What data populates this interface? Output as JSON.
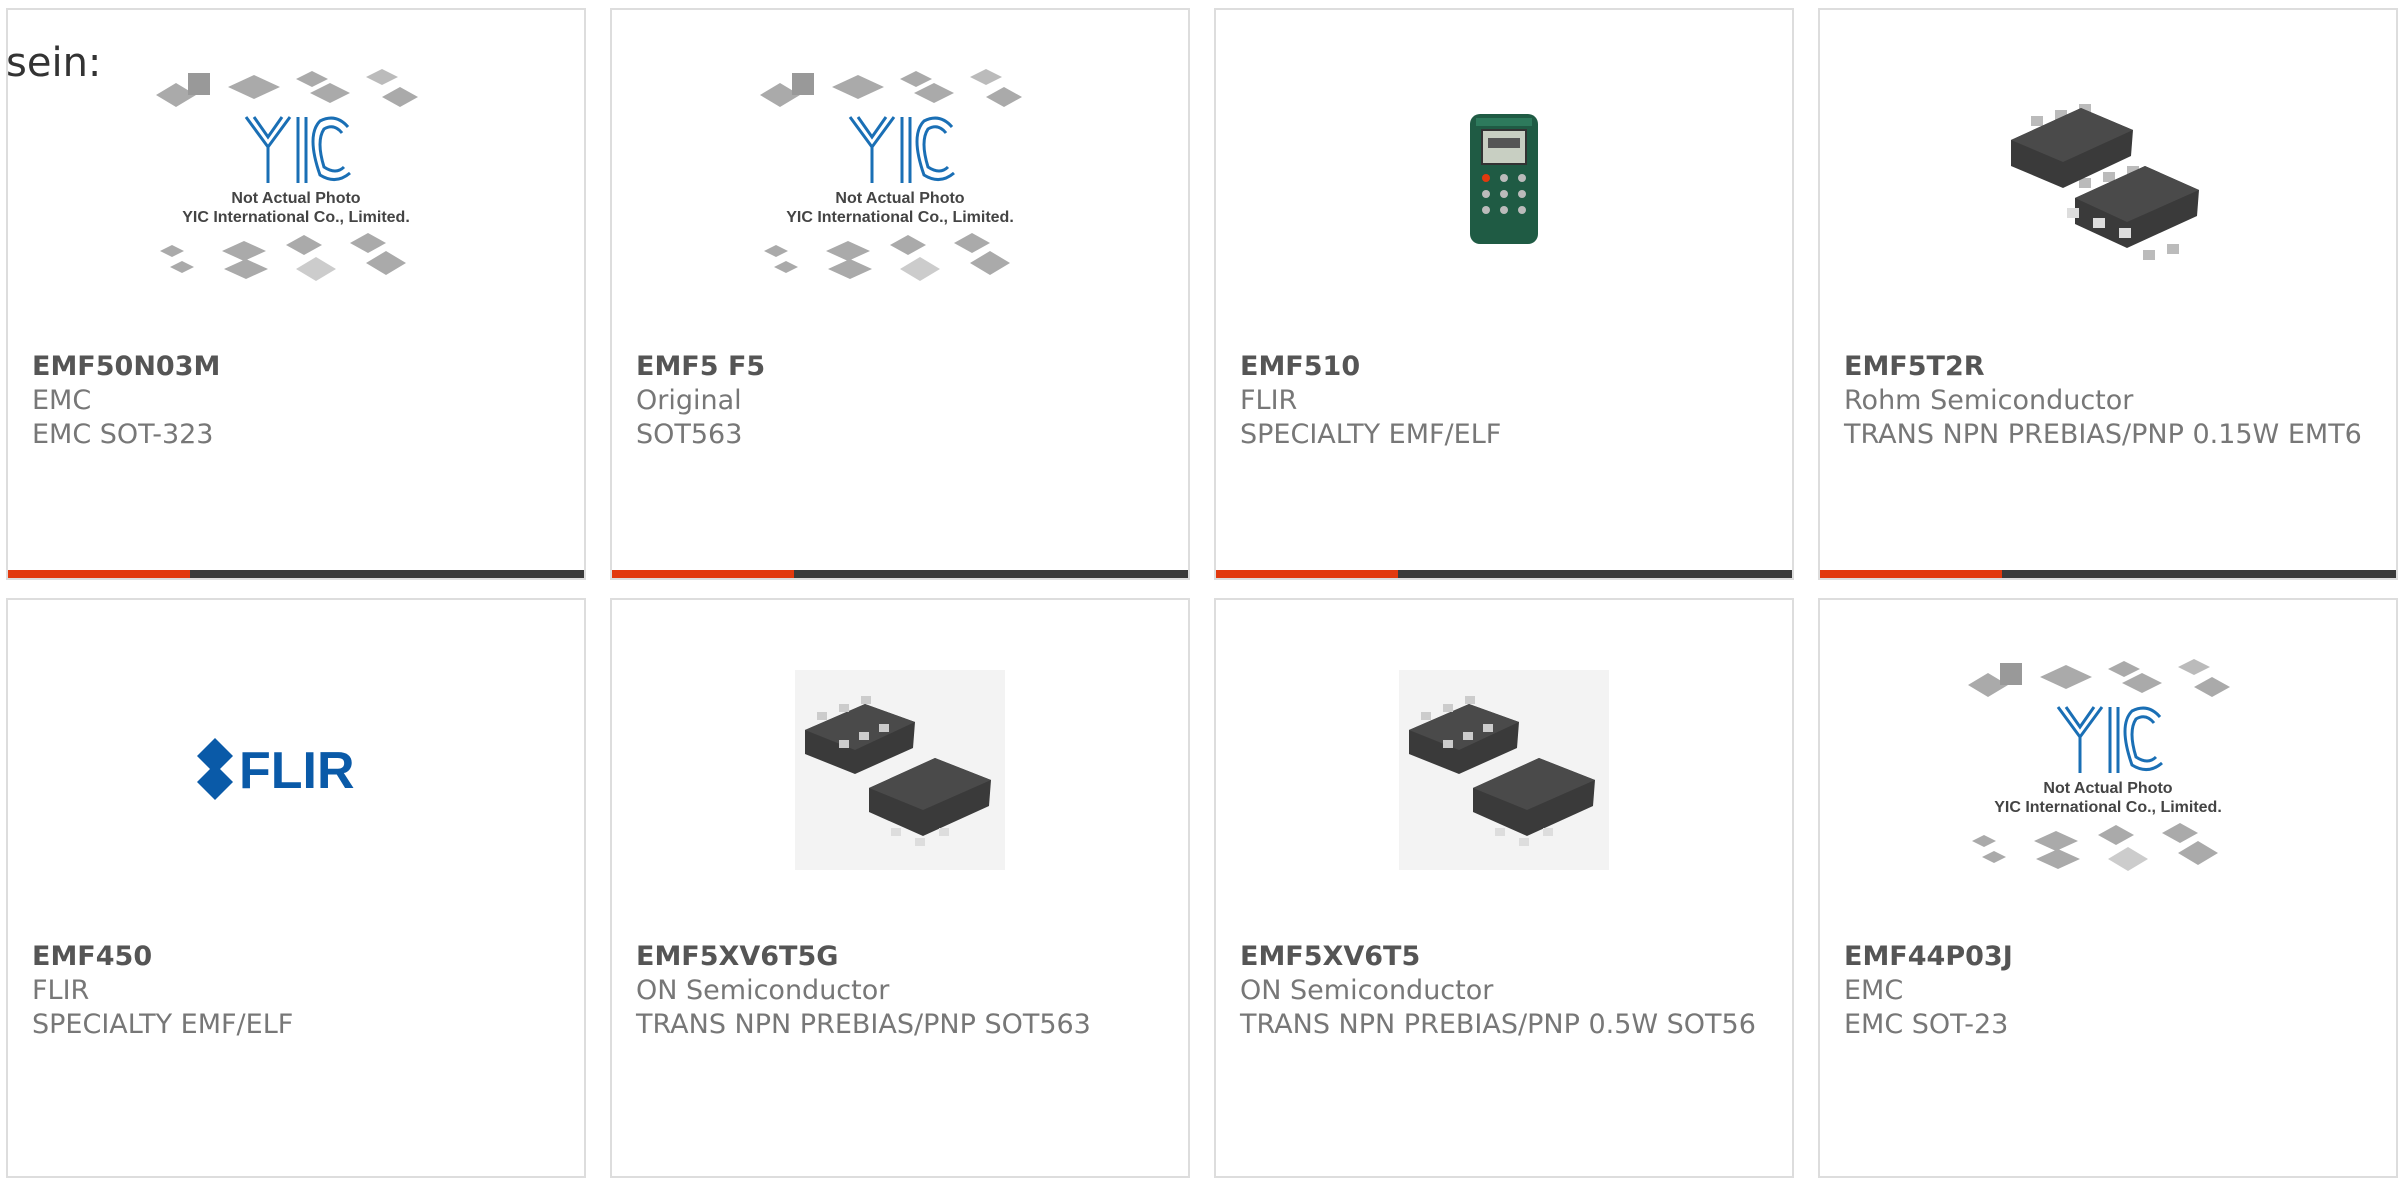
{
  "intro_text": "sein:",
  "placeholder": {
    "logo_text": "YIC",
    "line1": "Not Actual Photo",
    "line2": "YIC International Co., Limited."
  },
  "flir_logo_text": "FLIR",
  "colors": {
    "accent": "#e2390e",
    "bar": "#3a3a3a",
    "border": "#dddddd",
    "flir_blue": "#0a5aa8"
  },
  "products": [
    {
      "part": "EMF50N03M",
      "maker": "EMC",
      "desc": "EMC SOT-323",
      "image": "yic-placeholder"
    },
    {
      "part": "EMF5 F5",
      "maker": "Original",
      "desc": "SOT563",
      "image": "yic-placeholder"
    },
    {
      "part": "EMF510",
      "maker": "FLIR",
      "desc": "SPECIALTY EMF/ELF",
      "image": "emf-meter"
    },
    {
      "part": "EMF5T2R",
      "maker": "Rohm Semiconductor",
      "desc": "TRANS NPN PREBIAS/PNP 0.15W EMT6",
      "image": "smd-chips"
    },
    {
      "part": "EMF450",
      "maker": "FLIR",
      "desc": "SPECIALTY EMF/ELF",
      "image": "flir-logo"
    },
    {
      "part": "EMF5XV6T5G",
      "maker": "ON Semiconductor",
      "desc": "TRANS NPN PREBIAS/PNP SOT563",
      "image": "smd-chips"
    },
    {
      "part": "EMF5XV6T5",
      "maker": "ON Semiconductor",
      "desc": "TRANS NPN PREBIAS/PNP 0.5W SOT56",
      "image": "smd-chips"
    },
    {
      "part": "EMF44P03J",
      "maker": "EMC",
      "desc": "EMC SOT-23",
      "image": "yic-placeholder"
    }
  ]
}
